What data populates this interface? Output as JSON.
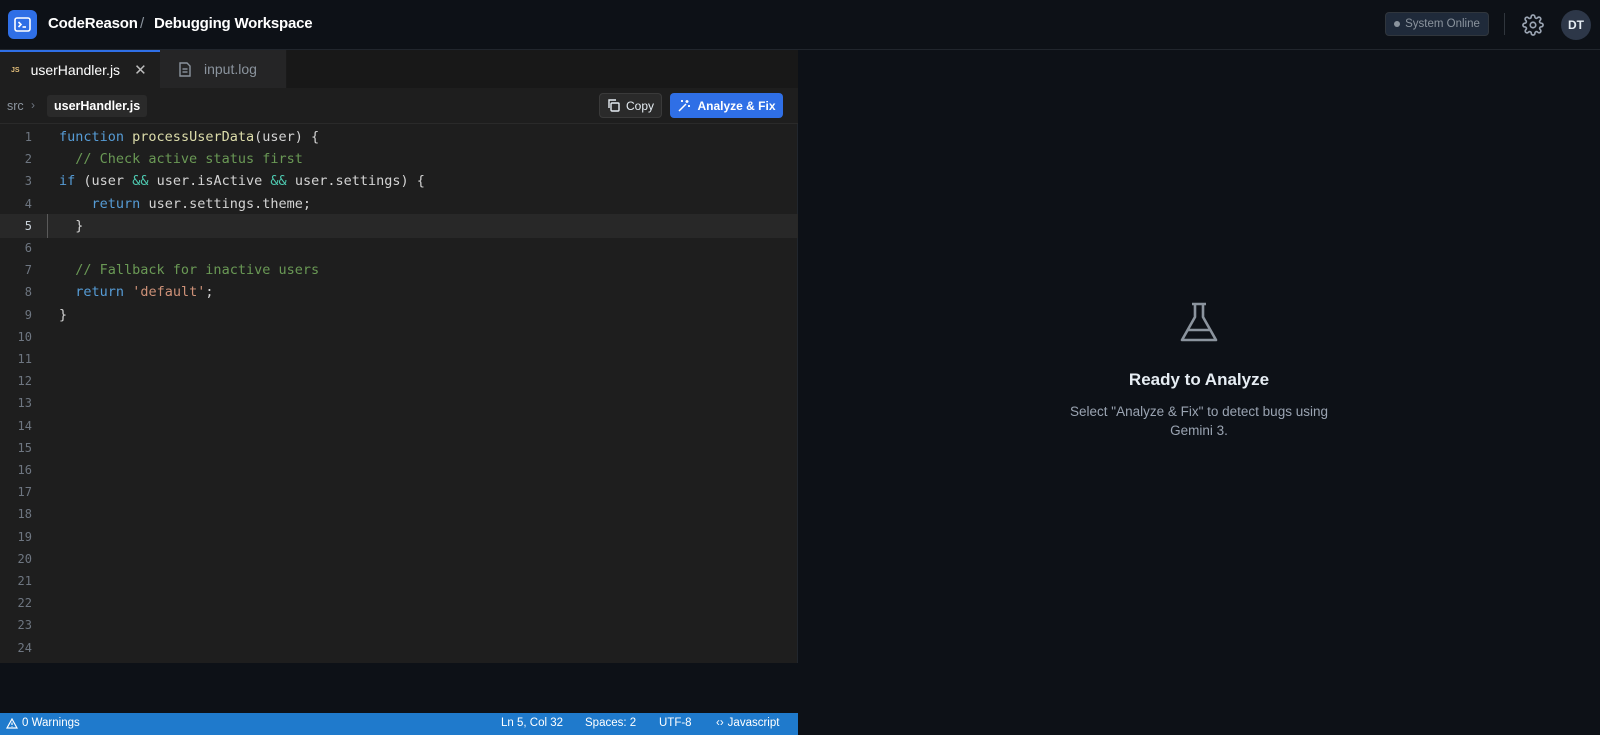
{
  "header": {
    "app_name": "CodeReason",
    "separator": "/",
    "workspace_title": "Debugging Workspace",
    "status": "System Online",
    "avatar_initials": "DT"
  },
  "editor": {
    "tabs": [
      {
        "label": "userHandler.js",
        "icon": "js-file-icon",
        "badge": "JS",
        "active": true
      },
      {
        "label": "input.log",
        "icon": "file-text-icon",
        "active": false
      }
    ],
    "breadcrumb": {
      "folder": "src",
      "file": "userHandler.js"
    },
    "copy_label": "Copy",
    "analyze_label": "Analyze & Fix",
    "current_line": 5,
    "line_numbers": [
      "1",
      "2",
      "3",
      "4",
      "5",
      "6",
      "7",
      "8",
      "9",
      "10",
      "11",
      "12",
      "13",
      "14",
      "15",
      "16",
      "17",
      "18",
      "19",
      "20",
      "21",
      "22",
      "23",
      "24"
    ],
    "code_lines": [
      "function processUserData(user) {",
      "  // Check active status first",
      "if (user && user.isActive && user.settings) {",
      "    return user.settings.theme;",
      "  }",
      "",
      "  // Fallback for inactive users",
      "  return 'default';",
      "}"
    ]
  },
  "statusbar": {
    "warnings": "0 Warnings",
    "position": "Ln 5, Col 32",
    "spaces": "Spaces: 2",
    "encoding": "UTF-8",
    "language": "Javascript"
  },
  "panel": {
    "icon": "flask-icon",
    "title": "Ready to Analyze",
    "description": "Select \"Analyze & Fix\" to detect bugs using Gemini 3."
  },
  "colors": {
    "accent": "#2f6fe6",
    "statusbar": "#1f7acc",
    "editor_bg": "#1e1e1e",
    "app_bg": "#0d1117"
  }
}
